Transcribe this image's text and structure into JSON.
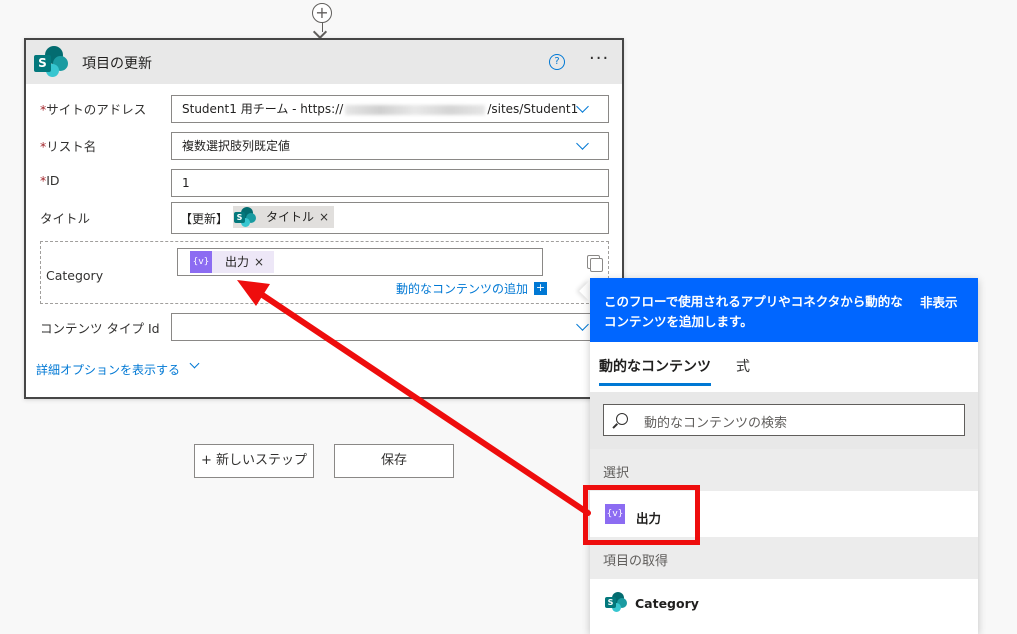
{
  "card": {
    "title": "項目の更新",
    "help_glyph": "?",
    "more_glyph": "···"
  },
  "fields": {
    "site_address": {
      "required_mark": "*",
      "label": "サイトのアドレス",
      "value_prefix": "Student1 用チーム - https://",
      "value_suffix": "/sites/Student1"
    },
    "list_name": {
      "required_mark": "*",
      "label": "リスト名",
      "value": "複数選択肢列既定値"
    },
    "id": {
      "required_mark": "*",
      "label": "ID",
      "value": "1"
    },
    "title": {
      "label": "タイトル",
      "prefix_text": "【更新】",
      "token_label": "タイトル",
      "token_close": "×"
    },
    "category": {
      "label": "Category",
      "token_label": "出力",
      "token_close": "×",
      "var_icon_text": "{v}",
      "add_dynamic_label": "動的なコンテンツの追加",
      "add_dynamic_plus": "+"
    },
    "content_type_id": {
      "label": "コンテンツ タイプ Id",
      "value": ""
    }
  },
  "advanced_options_label": "詳細オプションを表示する",
  "buttons": {
    "new_step": "+ 新しいステップ",
    "save": "保存"
  },
  "panel": {
    "header_text": "このフローで使用されるアプリやコネクタから動的なコンテンツを追加します。",
    "hide_label": "非表示",
    "tabs": [
      "動的なコンテンツ",
      "式"
    ],
    "search_placeholder": "動的なコンテンツの検索",
    "sections": [
      {
        "label": "選択",
        "items": [
          {
            "label": "出力",
            "icon": "variable-icon"
          }
        ]
      },
      {
        "label": "項目の取得",
        "items": [
          {
            "label": "Category",
            "icon": "sharepoint-icon"
          }
        ]
      }
    ]
  },
  "colors": {
    "accent": "#0078d4",
    "panel_header": "#0066ff",
    "annotation": "#ee0d0d",
    "variable_icon": "#8c6cf2",
    "sharepoint": "#036c70"
  }
}
